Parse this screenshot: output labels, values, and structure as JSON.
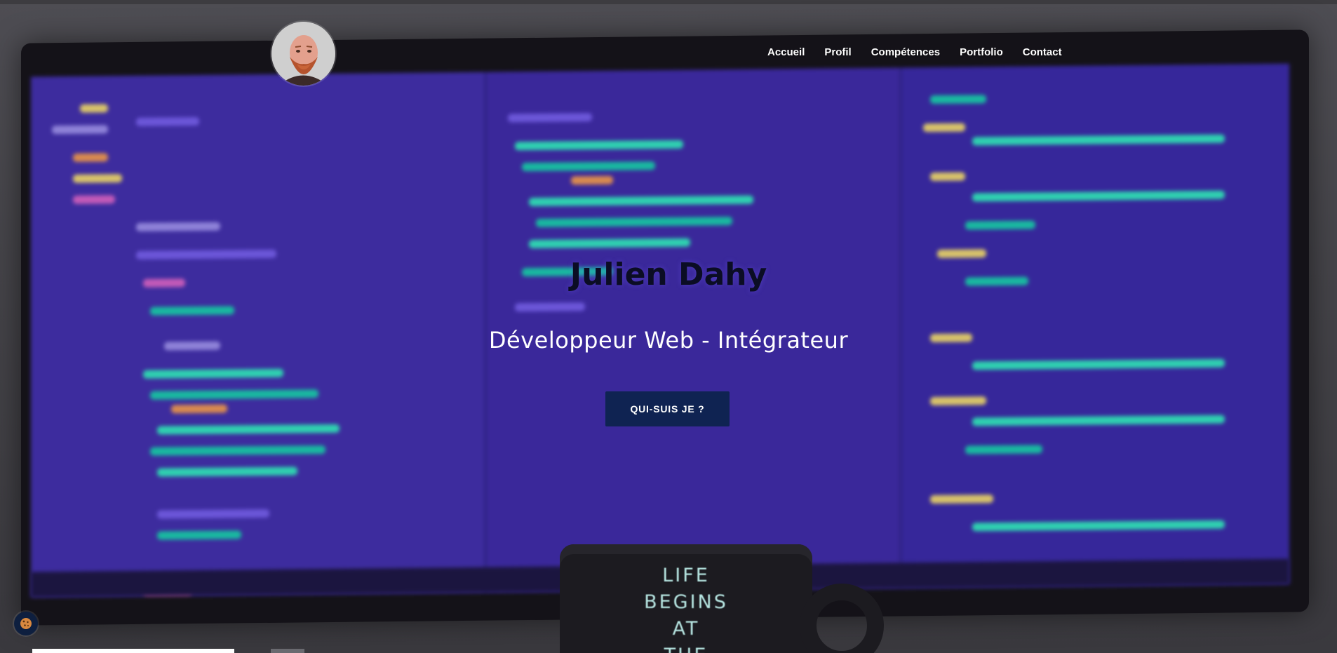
{
  "header": {
    "avatar_alt": "Julien Dahy avatar",
    "nav": [
      {
        "label": "Accueil"
      },
      {
        "label": "Profil"
      },
      {
        "label": "Compétences"
      },
      {
        "label": "Portfolio"
      },
      {
        "label": "Contact"
      }
    ]
  },
  "hero": {
    "title": "Julien Dahy",
    "subtitle": "Développeur Web - Intégrateur",
    "cta_label": "QUI-SUIS JE ?"
  },
  "background": {
    "mug_text": [
      "LIFE",
      "BEGINS",
      "AT",
      "THE"
    ]
  },
  "colors": {
    "cta_background": "#0f2352",
    "title_color": "#0b0d24",
    "screen_purple": "#3c2a9f",
    "code_teal": "#19b8a0"
  },
  "icons": {
    "cookie": "cookie-icon"
  }
}
